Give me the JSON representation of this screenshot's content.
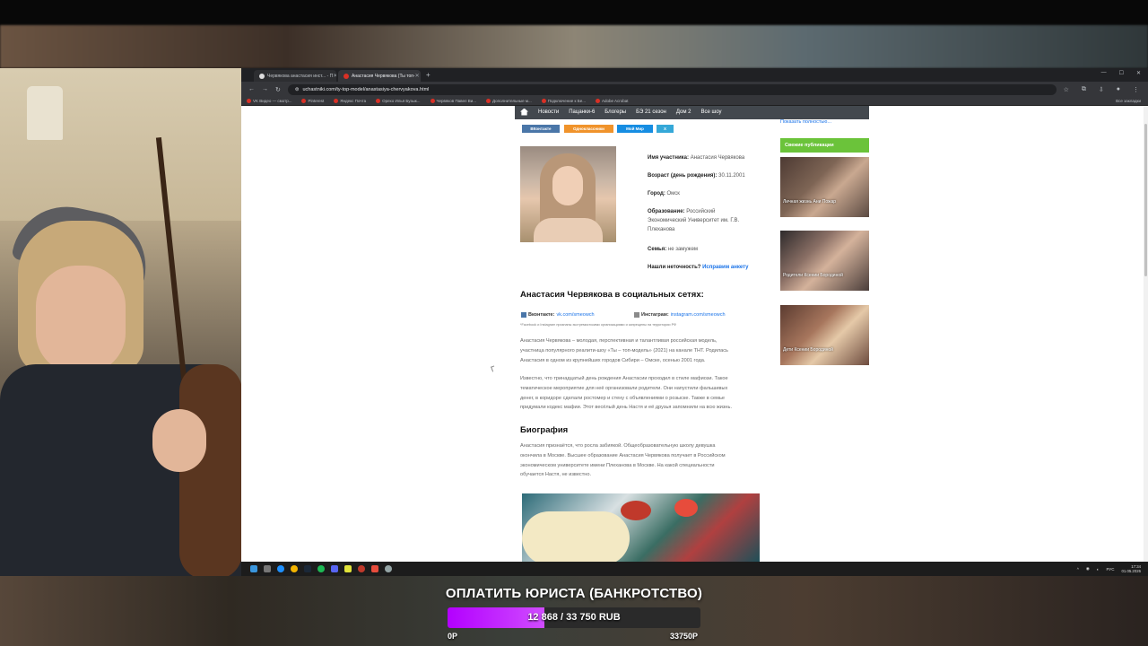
{
  "browser": {
    "tabs": [
      {
        "label": "Червякова анастасия инст... - П"
      },
      {
        "label": "Анастасия Червякова (Ты топ-"
      }
    ],
    "url": "uchastniki.com/ty-top-model/anastasiya-chervyakova.html",
    "bookmarks": [
      "VK Видео — смотр...",
      "Pinterest",
      "Яндекс Почта",
      "Орехо Илья Бузык...",
      "Червяков Павел Ви...",
      "Дополнительные м...",
      "Подключение к Бе...",
      "Adobe Acrobat"
    ],
    "bookmarks_right": "Все закладки"
  },
  "site": {
    "nav": [
      "Новости",
      "Пацанки-6",
      "Блогеры",
      "БЭ 21 сезон",
      "Дом 2",
      "Все шоу"
    ],
    "share": [
      {
        "label": "ВКонтакте",
        "color": "#4a76a8"
      },
      {
        "label": "Одноклассники",
        "color": "#f0932b"
      },
      {
        "label": "Мой Мир",
        "color": "#168de2"
      },
      {
        "label": "X",
        "color": "#35a8d8"
      }
    ],
    "profile": {
      "name_label": "Имя участника:",
      "name": "Анастасия Червякова",
      "age_label": "Возраст (день рождения):",
      "age": "30.11.2001",
      "city_label": "Город:",
      "city": "Омск",
      "edu_label": "Образование:",
      "edu1": "Российский",
      "edu2": "Экономический Университет им. Г.В.",
      "edu3": "Плеханова",
      "family_label": "Семья:",
      "family": "не замужем",
      "fix_label": "Нашли неточность?",
      "fix_link": "Исправим анкету"
    },
    "social_heading": "Анастасия Червякова в социальных сетях:",
    "vk_label": "Вконтакте:",
    "vk_link": "vk.com/smeowch",
    "ig_label": "Инстаграм:",
    "ig_link": "instagram.com/smeowch",
    "note": "*Facebook и Instagram признаны экстремистскими организациями и запрещены на территории РФ",
    "para1": [
      "Анастасия Червякова – молодая, перспективная и талантливая российская модель,",
      "участница популярного реалити-шоу «Ты – топ-модель» (2021) на канале ТНТ. Родилась",
      "Анастасия в одном из крупнейших городов Сибири – Омске, осенью 2001 года."
    ],
    "para2": [
      "Известно, что тринадцатый день рождения Анастасии проходил в стиле мафиози. Такое",
      "тематическое мероприятие для неё организовали родители. Они напустили фальшивых",
      "денег, в коридоре сделали ростомер и стену с объявлениями о розыске. Также в семье",
      "придумали кодекс мафии. Этот весёлый день Настя и её друзья запомнили на всю жизнь."
    ],
    "bio_heading": "Биография",
    "para3": [
      "Анастасия признаётся, что росла забиякой. Общеобразовательную школу девушка",
      "окончила в Москве. Высшее образование Анастасия Червякова получает в Российском",
      "экономическом университете имени Плеханова в Москве. На какой специальности",
      "обучается Настя, не известно."
    ],
    "sidebar": {
      "read_more": "Показать полностью...",
      "header": "Свежие публикации",
      "cards": [
        "Личная жизнь Ани Пожар",
        "Родители Ксении Бородиной",
        "Дети Ксении Бородиной"
      ]
    }
  },
  "taskbar": {
    "lang": "РУС",
    "time": "17:34",
    "date": "01.05.2026"
  },
  "donation_goal": {
    "title": "ОПЛАТИТЬ ЮРИСТА (БАНКРОТСТВО)",
    "progress_text": "12 868 / 33 750 RUB",
    "current": 12868,
    "target": 33750,
    "min_label": "0Р",
    "max_label": "33750Р",
    "fill_color": "#c020ff"
  }
}
